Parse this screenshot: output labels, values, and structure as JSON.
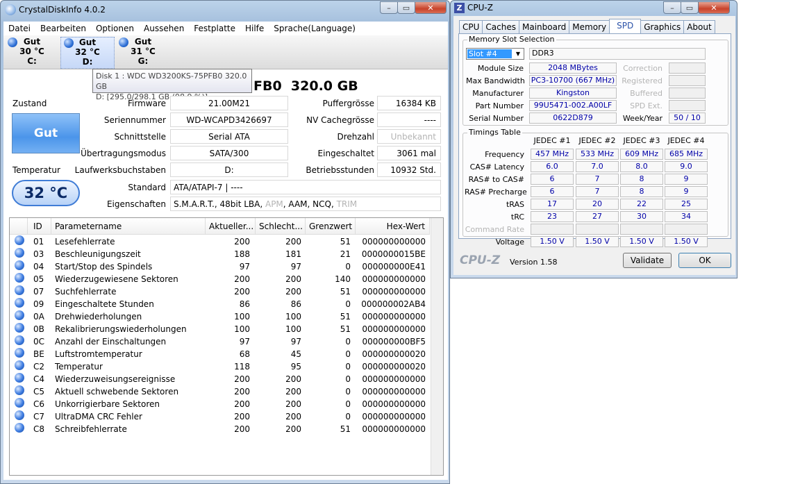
{
  "cdi": {
    "title": "CrystalDiskInfo 4.0.2",
    "menu": [
      "Datei",
      "Bearbeiten",
      "Optionen",
      "Aussehen",
      "Festplatte",
      "Hilfe",
      "Sprache(Language)"
    ],
    "drives": [
      {
        "status": "Gut",
        "temp": "30 °C",
        "letter": "C:"
      },
      {
        "status": "Gut",
        "temp": "32 °C",
        "letter": "D:"
      },
      {
        "status": "Gut",
        "temp": "31 °C",
        "letter": "G:"
      }
    ],
    "tooltip": {
      "line1": "Disk 1 : WDC WD3200KS-75PFB0 320.0 GB",
      "line2": "D: [295.0/298.1 GB (98.9 %)]"
    },
    "model_title": "FB0  320.0 GB",
    "zustand_label": "Zustand",
    "health": "Gut",
    "temperatur_label": "Temperatur",
    "temperature": "32 °C",
    "firmware_label": "Firmware",
    "firmware": "21.00M21",
    "serial_label": "Seriennummer",
    "serial": "WD-WCAPD3426697",
    "interface_label": "Schnittstelle",
    "interface": "Serial ATA",
    "transfer_label": "Übertragungsmodus",
    "transfer": "SATA/300",
    "drive_letters_label": "Laufwerksbuchstaben",
    "drive_letters": "D:",
    "standard_label": "Standard",
    "standard": "ATA/ATAPI-7 | ----",
    "features_label": "Eigenschaften",
    "features": {
      "a": "S.M.A.R.T., 48bit LBA, ",
      "apm": "APM",
      "b": ", AAM, NCQ, ",
      "trim": "TRIM"
    },
    "buffer_label": "Puffergrösse",
    "buffer": "16384 KB",
    "nvcache_label": "NV Cachegrösse",
    "nvcache": "----",
    "rpm_label": "Drehzahl",
    "rpm": "Unbekannt",
    "poweron_count_label": "Eingeschaltet",
    "poweron_count": "3061 mal",
    "hours_label": "Betriebsstunden",
    "hours": "10932 Std.",
    "smart_headers": [
      "ID",
      "Parametername",
      "Aktueller...",
      "Schlecht...",
      "Grenzwert",
      "Hex-Wert"
    ],
    "smart_rows": [
      [
        "01",
        "Lesefehlerrate",
        "200",
        "200",
        "51",
        "000000000000"
      ],
      [
        "03",
        "Beschleunigungszeit",
        "188",
        "181",
        "21",
        "0000000015BE"
      ],
      [
        "04",
        "Start/Stop des Spindels",
        "97",
        "97",
        "0",
        "000000000E41"
      ],
      [
        "05",
        "Wiederzugewiesene Sektoren",
        "200",
        "200",
        "140",
        "000000000000"
      ],
      [
        "07",
        "Suchfehlerrate",
        "200",
        "200",
        "51",
        "000000000000"
      ],
      [
        "09",
        "Eingeschaltete Stunden",
        "86",
        "86",
        "0",
        "000000002AB4"
      ],
      [
        "0A",
        "Drehwiederholungen",
        "100",
        "100",
        "51",
        "000000000000"
      ],
      [
        "0B",
        "Rekalibrierungswiederholungen",
        "100",
        "100",
        "51",
        "000000000000"
      ],
      [
        "0C",
        "Anzahl der Einschaltungen",
        "97",
        "97",
        "0",
        "000000000BF5"
      ],
      [
        "BE",
        "Luftstromtemperatur",
        "68",
        "45",
        "0",
        "000000000020"
      ],
      [
        "C2",
        "Temperatur",
        "118",
        "95",
        "0",
        "000000000020"
      ],
      [
        "C4",
        "Wiederzuweisungsereignisse",
        "200",
        "200",
        "0",
        "000000000000"
      ],
      [
        "C5",
        "Aktuell schwebende Sektoren",
        "200",
        "200",
        "0",
        "000000000000"
      ],
      [
        "C6",
        "Unkorrigierbare Sektoren",
        "200",
        "200",
        "0",
        "000000000000"
      ],
      [
        "C7",
        "UltraDMA CRC Fehler",
        "200",
        "200",
        "0",
        "000000000000"
      ],
      [
        "C8",
        "Schreibfehlerrate",
        "200",
        "200",
        "51",
        "000000000000"
      ]
    ]
  },
  "cpuz": {
    "title": "CPU-Z",
    "tabs": [
      "CPU",
      "Caches",
      "Mainboard",
      "Memory",
      "SPD",
      "Graphics",
      "About"
    ],
    "active_tab": "SPD",
    "slot_group": "Memory Slot Selection",
    "slot": "Slot #4",
    "mem_type": "DDR3",
    "module_size_label": "Module Size",
    "module_size": "2048 MBytes",
    "max_bw_label": "Max Bandwidth",
    "max_bw": "PC3-10700 (667 MHz)",
    "manufacturer_label": "Manufacturer",
    "manufacturer": "Kingston",
    "part_label": "Part Number",
    "part": "99U5471-002.A00LF",
    "serial_label": "Serial Number",
    "serial": "0622D879",
    "correction_label": "Correction",
    "registered_label": "Registered",
    "buffered_label": "Buffered",
    "spdext_label": "SPD Ext.",
    "weekyear_label": "Week/Year",
    "weekyear": "50 / 10",
    "timings_group": "Timings Table",
    "jedec": [
      "JEDEC #1",
      "JEDEC #2",
      "JEDEC #3",
      "JEDEC #4"
    ],
    "timing_rows": [
      {
        "label": "Frequency",
        "values": [
          "457 MHz",
          "533 MHz",
          "609 MHz",
          "685 MHz"
        ]
      },
      {
        "label": "CAS# Latency",
        "values": [
          "6.0",
          "7.0",
          "8.0",
          "9.0"
        ]
      },
      {
        "label": "RAS# to CAS#",
        "values": [
          "6",
          "7",
          "8",
          "9"
        ]
      },
      {
        "label": "RAS# Precharge",
        "values": [
          "6",
          "7",
          "8",
          "9"
        ]
      },
      {
        "label": "tRAS",
        "values": [
          "17",
          "20",
          "22",
          "25"
        ]
      },
      {
        "label": "tRC",
        "values": [
          "23",
          "27",
          "30",
          "34"
        ]
      },
      {
        "label": "Command Rate",
        "values": [
          "",
          "",
          "",
          ""
        ],
        "disabled": true
      },
      {
        "label": "Voltage",
        "values": [
          "1.50 V",
          "1.50 V",
          "1.50 V",
          "1.50 V"
        ]
      }
    ],
    "brand": "CPU-Z",
    "version": "Version 1.58",
    "validate": "Validate",
    "ok": "OK"
  }
}
